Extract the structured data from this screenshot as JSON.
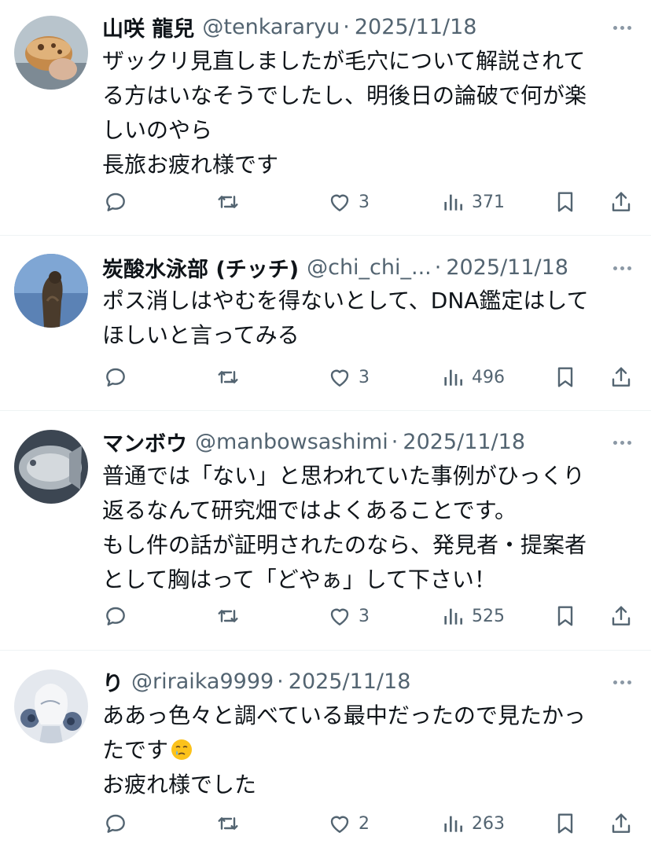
{
  "tweets": [
    {
      "name": "山咲 龍兒",
      "handle": "@tenkararyu",
      "dot": "·",
      "date": "2025/11/18",
      "lines": [
        "ザックリ見直しましたが毛穴について解説されて",
        "る方はいなそうでしたし、明後日の論破で何が楽",
        "しいのやら",
        "長旅お疲れ様です"
      ],
      "likes": "3",
      "views": "371"
    },
    {
      "name": "炭酸水泳部 (チッチ)",
      "handle": "@chi_chi_...",
      "dot": "·",
      "date": "2025/11/18",
      "lines": [
        "ポス消しはやむを得ないとして、DNA鑑定はして",
        "ほしいと言ってみる"
      ],
      "likes": "3",
      "views": "496"
    },
    {
      "name": "マンボウ",
      "handle": "@manbowsashimi",
      "dot": "·",
      "date": "2025/11/18",
      "lines": [
        "普通では「ない」と思われていた事例がひっくり",
        "返るなんて研究畑ではよくあることです。",
        "もし件の話が証明されたのなら、発見者・提案者",
        "として胸はって「どやぁ」して下さい！"
      ],
      "likes": "3",
      "views": "525"
    },
    {
      "name": "り",
      "handle": "@riraika9999",
      "dot": "·",
      "date": "2025/11/18",
      "lines": [
        "ああっ色々と調べている最中だったので見たかっ",
        "たです",
        "お疲れ様でした"
      ],
      "emoji_line": 1,
      "emoji": "face-holding-back-tears",
      "likes": "2",
      "views": "263"
    }
  ],
  "colors": {
    "text": "#0f1419",
    "secondary": "#536471",
    "divider": "#eff3f4"
  },
  "icons": [
    "reply-icon",
    "repost-icon",
    "like-icon",
    "views-icon",
    "bookmark-icon",
    "share-icon",
    "more-icon"
  ]
}
